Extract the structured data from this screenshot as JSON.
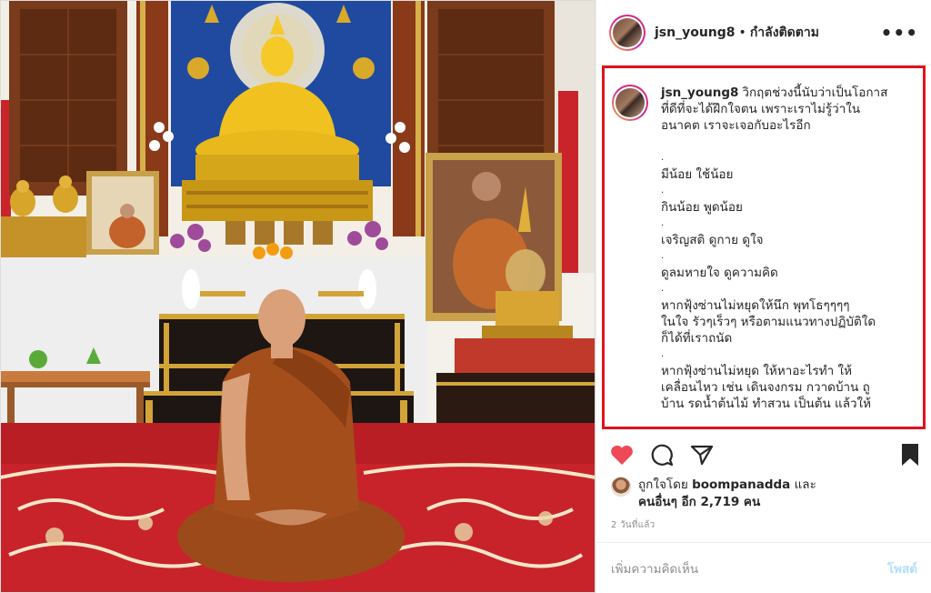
{
  "post": {
    "username": "jsn_young8",
    "header_separator": "•",
    "follow_status": "กำลังติดตาม",
    "more_label": "•••",
    "caption_lines": [
      "วิกฤตช่วงนี้นับว่าเป็นโอกาส",
      "ที่ดีที่จะได้ฝึกใจตน เพราะเราไม่รู้ว่าใน",
      "อนาคต เราจะเจอกับอะไรอีก",
      "",
      ".",
      "มีน้อย ใช้น้อย",
      ".",
      "กินน้อย พูดน้อย",
      ".",
      "เจริญสติ ดูกาย ดูใจ",
      ".",
      "ดูลมหายใจ ดูความคิด",
      ".",
      "หากฟุ้งซ่านไม่หยุดให้นึก พุทโธๆๆๆๆ",
      "ในใจ รัวๆเร็วๆ หรือตามแนวทางปฏิบัติใด",
      "ก็ได้ที่เราถนัด",
      ".",
      "หากฟุ้งซ่านไม่หยุด ให้หาอะไรทำ ให้",
      "เคลื่อนไหว เช่น เดินจงกรม กวาดบ้าน ถู",
      "บ้าน รดน้ำต้นไม้ ทำสวน เป็นต้น แล้วให้"
    ],
    "likes_prefix": "ถูกใจโดย",
    "liked_by": "boompanadda",
    "likes_and": "และ",
    "likes_others": "คนอื่นๆ อีก 2,719 คน",
    "time_ago": "2 วันที่แล้ว",
    "comment_placeholder": "เพิ่มความคิดเห็น",
    "post_button": "โพสต์"
  },
  "colors": {
    "like_red": "#ed4956",
    "highlight_border": "#e0131d",
    "post_button_disabled": "#b2dffc"
  },
  "icons": [
    "heart-icon",
    "comment-icon",
    "share-icon",
    "bookmark-icon",
    "more-icon"
  ]
}
